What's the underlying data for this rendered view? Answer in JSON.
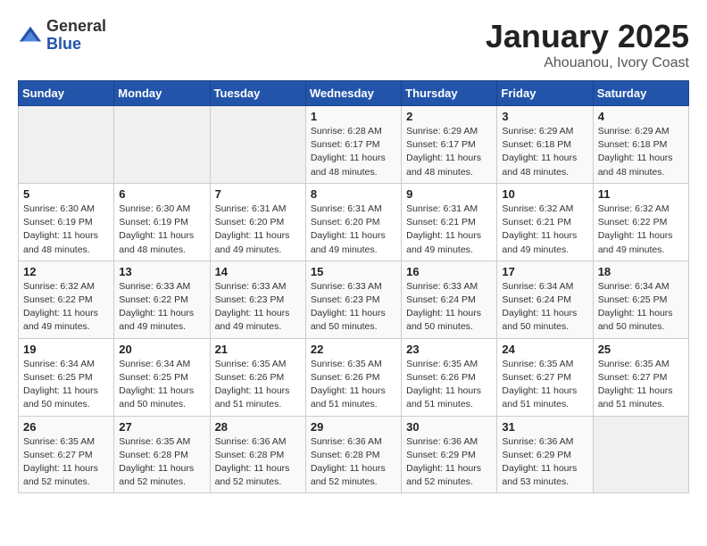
{
  "logo": {
    "general": "General",
    "blue": "Blue"
  },
  "header": {
    "month": "January 2025",
    "location": "Ahouanou, Ivory Coast"
  },
  "weekdays": [
    "Sunday",
    "Monday",
    "Tuesday",
    "Wednesday",
    "Thursday",
    "Friday",
    "Saturday"
  ],
  "weeks": [
    [
      {
        "day": "",
        "info": ""
      },
      {
        "day": "",
        "info": ""
      },
      {
        "day": "",
        "info": ""
      },
      {
        "day": "1",
        "info": "Sunrise: 6:28 AM\nSunset: 6:17 PM\nDaylight: 11 hours\nand 48 minutes."
      },
      {
        "day": "2",
        "info": "Sunrise: 6:29 AM\nSunset: 6:17 PM\nDaylight: 11 hours\nand 48 minutes."
      },
      {
        "day": "3",
        "info": "Sunrise: 6:29 AM\nSunset: 6:18 PM\nDaylight: 11 hours\nand 48 minutes."
      },
      {
        "day": "4",
        "info": "Sunrise: 6:29 AM\nSunset: 6:18 PM\nDaylight: 11 hours\nand 48 minutes."
      }
    ],
    [
      {
        "day": "5",
        "info": "Sunrise: 6:30 AM\nSunset: 6:19 PM\nDaylight: 11 hours\nand 48 minutes."
      },
      {
        "day": "6",
        "info": "Sunrise: 6:30 AM\nSunset: 6:19 PM\nDaylight: 11 hours\nand 48 minutes."
      },
      {
        "day": "7",
        "info": "Sunrise: 6:31 AM\nSunset: 6:20 PM\nDaylight: 11 hours\nand 49 minutes."
      },
      {
        "day": "8",
        "info": "Sunrise: 6:31 AM\nSunset: 6:20 PM\nDaylight: 11 hours\nand 49 minutes."
      },
      {
        "day": "9",
        "info": "Sunrise: 6:31 AM\nSunset: 6:21 PM\nDaylight: 11 hours\nand 49 minutes."
      },
      {
        "day": "10",
        "info": "Sunrise: 6:32 AM\nSunset: 6:21 PM\nDaylight: 11 hours\nand 49 minutes."
      },
      {
        "day": "11",
        "info": "Sunrise: 6:32 AM\nSunset: 6:22 PM\nDaylight: 11 hours\nand 49 minutes."
      }
    ],
    [
      {
        "day": "12",
        "info": "Sunrise: 6:32 AM\nSunset: 6:22 PM\nDaylight: 11 hours\nand 49 minutes."
      },
      {
        "day": "13",
        "info": "Sunrise: 6:33 AM\nSunset: 6:22 PM\nDaylight: 11 hours\nand 49 minutes."
      },
      {
        "day": "14",
        "info": "Sunrise: 6:33 AM\nSunset: 6:23 PM\nDaylight: 11 hours\nand 49 minutes."
      },
      {
        "day": "15",
        "info": "Sunrise: 6:33 AM\nSunset: 6:23 PM\nDaylight: 11 hours\nand 50 minutes."
      },
      {
        "day": "16",
        "info": "Sunrise: 6:33 AM\nSunset: 6:24 PM\nDaylight: 11 hours\nand 50 minutes."
      },
      {
        "day": "17",
        "info": "Sunrise: 6:34 AM\nSunset: 6:24 PM\nDaylight: 11 hours\nand 50 minutes."
      },
      {
        "day": "18",
        "info": "Sunrise: 6:34 AM\nSunset: 6:25 PM\nDaylight: 11 hours\nand 50 minutes."
      }
    ],
    [
      {
        "day": "19",
        "info": "Sunrise: 6:34 AM\nSunset: 6:25 PM\nDaylight: 11 hours\nand 50 minutes."
      },
      {
        "day": "20",
        "info": "Sunrise: 6:34 AM\nSunset: 6:25 PM\nDaylight: 11 hours\nand 50 minutes."
      },
      {
        "day": "21",
        "info": "Sunrise: 6:35 AM\nSunset: 6:26 PM\nDaylight: 11 hours\nand 51 minutes."
      },
      {
        "day": "22",
        "info": "Sunrise: 6:35 AM\nSunset: 6:26 PM\nDaylight: 11 hours\nand 51 minutes."
      },
      {
        "day": "23",
        "info": "Sunrise: 6:35 AM\nSunset: 6:26 PM\nDaylight: 11 hours\nand 51 minutes."
      },
      {
        "day": "24",
        "info": "Sunrise: 6:35 AM\nSunset: 6:27 PM\nDaylight: 11 hours\nand 51 minutes."
      },
      {
        "day": "25",
        "info": "Sunrise: 6:35 AM\nSunset: 6:27 PM\nDaylight: 11 hours\nand 51 minutes."
      }
    ],
    [
      {
        "day": "26",
        "info": "Sunrise: 6:35 AM\nSunset: 6:27 PM\nDaylight: 11 hours\nand 52 minutes."
      },
      {
        "day": "27",
        "info": "Sunrise: 6:35 AM\nSunset: 6:28 PM\nDaylight: 11 hours\nand 52 minutes."
      },
      {
        "day": "28",
        "info": "Sunrise: 6:36 AM\nSunset: 6:28 PM\nDaylight: 11 hours\nand 52 minutes."
      },
      {
        "day": "29",
        "info": "Sunrise: 6:36 AM\nSunset: 6:28 PM\nDaylight: 11 hours\nand 52 minutes."
      },
      {
        "day": "30",
        "info": "Sunrise: 6:36 AM\nSunset: 6:29 PM\nDaylight: 11 hours\nand 52 minutes."
      },
      {
        "day": "31",
        "info": "Sunrise: 6:36 AM\nSunset: 6:29 PM\nDaylight: 11 hours\nand 53 minutes."
      },
      {
        "day": "",
        "info": ""
      }
    ]
  ]
}
